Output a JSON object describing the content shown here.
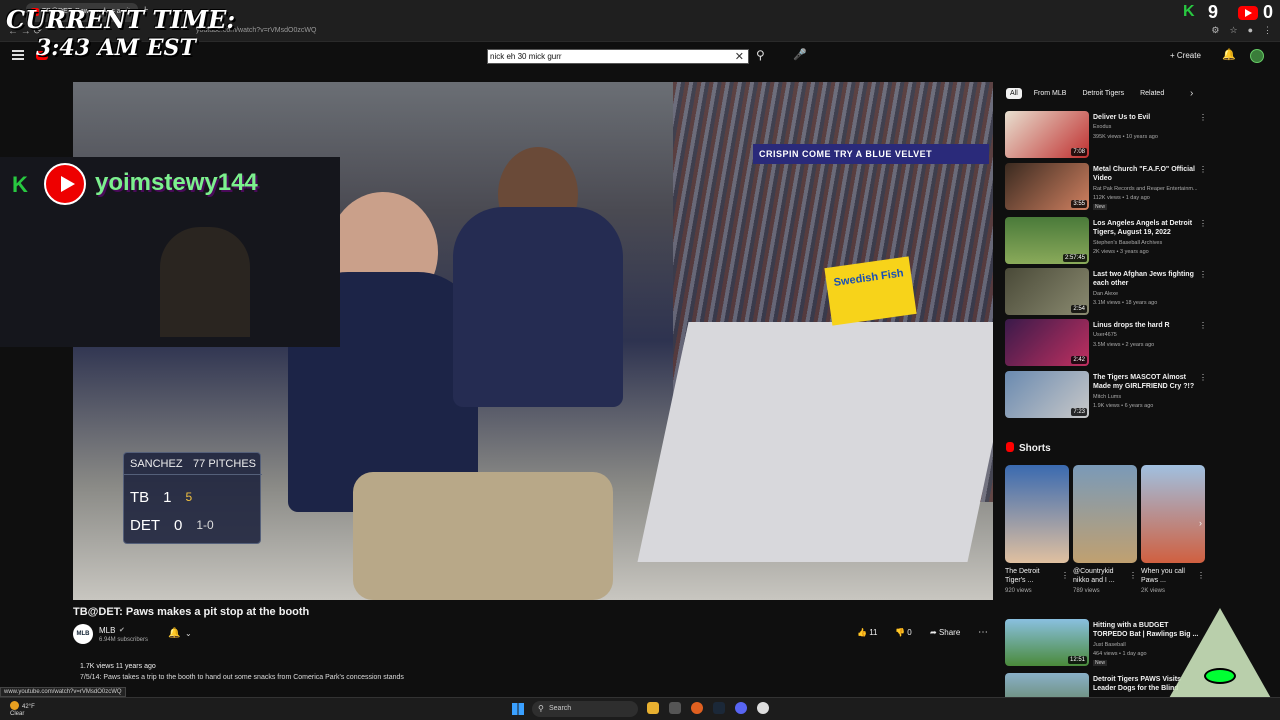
{
  "browser": {
    "tab_title": "TB@DET: Paws makes a pit",
    "new_tab": "+",
    "url": "youtube.com/watch?v=rVMsdO0zcWQ",
    "status_url": "www.youtube.com/watch?v=rVMsdO0zcWQ"
  },
  "header": {
    "search_value": "nick eh 30 mick gurr",
    "create_label": "Create"
  },
  "overlay": {
    "clock_line1": "CURRENT TIME:",
    "clock_line2": "3:43 AM EST",
    "streamer": "yoimstewy144",
    "kick_count": "9",
    "yt_count": "0"
  },
  "video": {
    "title": "TB@DET: Paws makes a pit stop at the booth",
    "banner": "CRISPIN   COME TRY A BLUE VELVET",
    "candy": "Swedish Fish",
    "scorebug": {
      "pitcher": "SANCHEZ",
      "pitches": "77 PITCHES",
      "team1": "TB",
      "score1": "1",
      "inning": "5",
      "team2": "DET",
      "score2": "0",
      "count": "1-0"
    }
  },
  "channel": {
    "avatar": "MLB",
    "name": "MLB",
    "subs": "6.94M subscribers"
  },
  "actions": {
    "likes": "11",
    "dislikes": "0",
    "share": "Share"
  },
  "description": {
    "meta": "1.7K views  11 years ago",
    "text": "7/5/14: Paws takes a trip to the booth to hand out some snacks from Comerica Park's concession stands"
  },
  "chips": [
    "All",
    "From MLB",
    "Detroit Tigers",
    "Related"
  ],
  "recommendations": [
    {
      "title": "Deliver Us to Evil",
      "channel": "Exodus",
      "meta": "395K views • 10 years ago",
      "duration": "7:08",
      "new": ""
    },
    {
      "title": "Metal Church \"F.A.F.O\" Official Video",
      "channel": "Rat Pak Records and Reaper Entertainm...",
      "meta": "112K views • 1 day ago",
      "duration": "3:55",
      "new": "New"
    },
    {
      "title": "Los Angeles Angels at Detroit Tigers, August 19, 2022",
      "channel": "Stephen's Baseball Archives",
      "meta": "2K views • 3 years ago",
      "duration": "2:57:45",
      "new": ""
    },
    {
      "title": "Last two Afghan Jews fighting each other",
      "channel": "Dan Alexe",
      "meta": "3.1M views • 18 years ago",
      "duration": "2:54",
      "new": ""
    },
    {
      "title": "Linus drops the hard R",
      "channel": "User4675",
      "meta": "3.5M views • 2 years ago",
      "duration": "2:42",
      "new": ""
    },
    {
      "title": "The Tigers MASCOT Almost Made my GIRLFRIEND Cry ?!?",
      "channel": "Mitch Lums",
      "meta": "1.9K views • 6 years ago",
      "duration": "7:23",
      "new": ""
    }
  ],
  "shorts": {
    "heading": "Shorts",
    "items": [
      {
        "title": "The Detroit Tiger's ...",
        "views": "920 views"
      },
      {
        "title": "@Countrykid nikko and I ...",
        "views": "789 views"
      },
      {
        "title": "When you call Paws ...",
        "views": "2K views"
      }
    ]
  },
  "more_recs": [
    {
      "title": "Hitting with a BUDGET TORPEDO Bat | Rawlings Big ...",
      "channel": "Just Baseball",
      "meta": "464 views • 1 day ago",
      "duration": "12:51",
      "new": "New"
    },
    {
      "title": "Detroit Tigers PAWS Visits Leader Dogs for the Blind",
      "channel": "",
      "meta": "",
      "duration": "",
      "new": ""
    }
  ],
  "taskbar": {
    "temp": "42°F",
    "weather": "Clear",
    "search": "Search"
  },
  "colors": {
    "youtube_red": "#ff0000",
    "kick_green": "#28c840",
    "streamer_name": "#7cf08e"
  }
}
